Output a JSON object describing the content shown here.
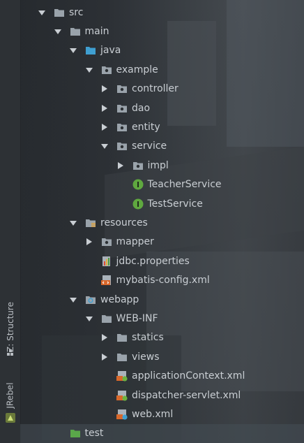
{
  "sidebar": {
    "tabs": [
      {
        "label": "Z: Structure"
      },
      {
        "label": "JRebel"
      }
    ]
  },
  "tree": {
    "nodes": [
      {
        "label": "src",
        "arrow": "down",
        "icon": "folder-gray-icon",
        "depth": 0
      },
      {
        "label": "main",
        "arrow": "down",
        "icon": "folder-gray-icon",
        "depth": 1
      },
      {
        "label": "java",
        "arrow": "down",
        "icon": "folder-source-blue-icon",
        "depth": 2
      },
      {
        "label": "example",
        "arrow": "down",
        "icon": "package-icon",
        "depth": 3
      },
      {
        "label": "controller",
        "arrow": "right",
        "icon": "package-icon",
        "depth": 4
      },
      {
        "label": "dao",
        "arrow": "right",
        "icon": "package-icon",
        "depth": 4
      },
      {
        "label": "entity",
        "arrow": "right",
        "icon": "package-icon",
        "depth": 4
      },
      {
        "label": "service",
        "arrow": "down",
        "icon": "package-icon",
        "depth": 4
      },
      {
        "label": "impl",
        "arrow": "right",
        "icon": "package-icon",
        "depth": 5
      },
      {
        "label": "TeacherService",
        "arrow": "none",
        "icon": "interface-icon",
        "depth": 5
      },
      {
        "label": "TestService",
        "arrow": "none",
        "icon": "interface-icon",
        "depth": 5
      },
      {
        "label": "resources",
        "arrow": "down",
        "icon": "resources-folder-icon",
        "depth": 2
      },
      {
        "label": "mapper",
        "arrow": "right",
        "icon": "package-icon",
        "depth": 3
      },
      {
        "label": "jdbc.properties",
        "arrow": "none",
        "icon": "properties-file-icon",
        "depth": 3
      },
      {
        "label": "mybatis-config.xml",
        "arrow": "none",
        "icon": "xml-file-icon",
        "depth": 3
      },
      {
        "label": "webapp",
        "arrow": "down",
        "icon": "web-folder-icon",
        "depth": 2
      },
      {
        "label": "WEB-INF",
        "arrow": "down",
        "icon": "folder-gray-icon",
        "depth": 3
      },
      {
        "label": "statics",
        "arrow": "right",
        "icon": "folder-gray-icon",
        "depth": 4
      },
      {
        "label": "views",
        "arrow": "right",
        "icon": "folder-gray-icon",
        "depth": 4
      },
      {
        "label": "applicationContext.xml",
        "arrow": "none",
        "icon": "spring-xml-icon",
        "depth": 4
      },
      {
        "label": "dispatcher-servlet.xml",
        "arrow": "none",
        "icon": "spring-xml-icon",
        "depth": 4
      },
      {
        "label": "web.xml",
        "arrow": "none",
        "icon": "web-xml-icon",
        "depth": 4
      },
      {
        "label": "test",
        "arrow": "none",
        "icon": "folder-test-green-icon",
        "depth": 1
      }
    ]
  },
  "colors": {
    "folder_gray": "#9aa3ab",
    "folder_blue": "#3f9fd1",
    "folder_green": "#5aa74a",
    "interface_green": "#5fa83f",
    "xml_orange": "#d9682b",
    "arrow": "#c9ced3"
  }
}
